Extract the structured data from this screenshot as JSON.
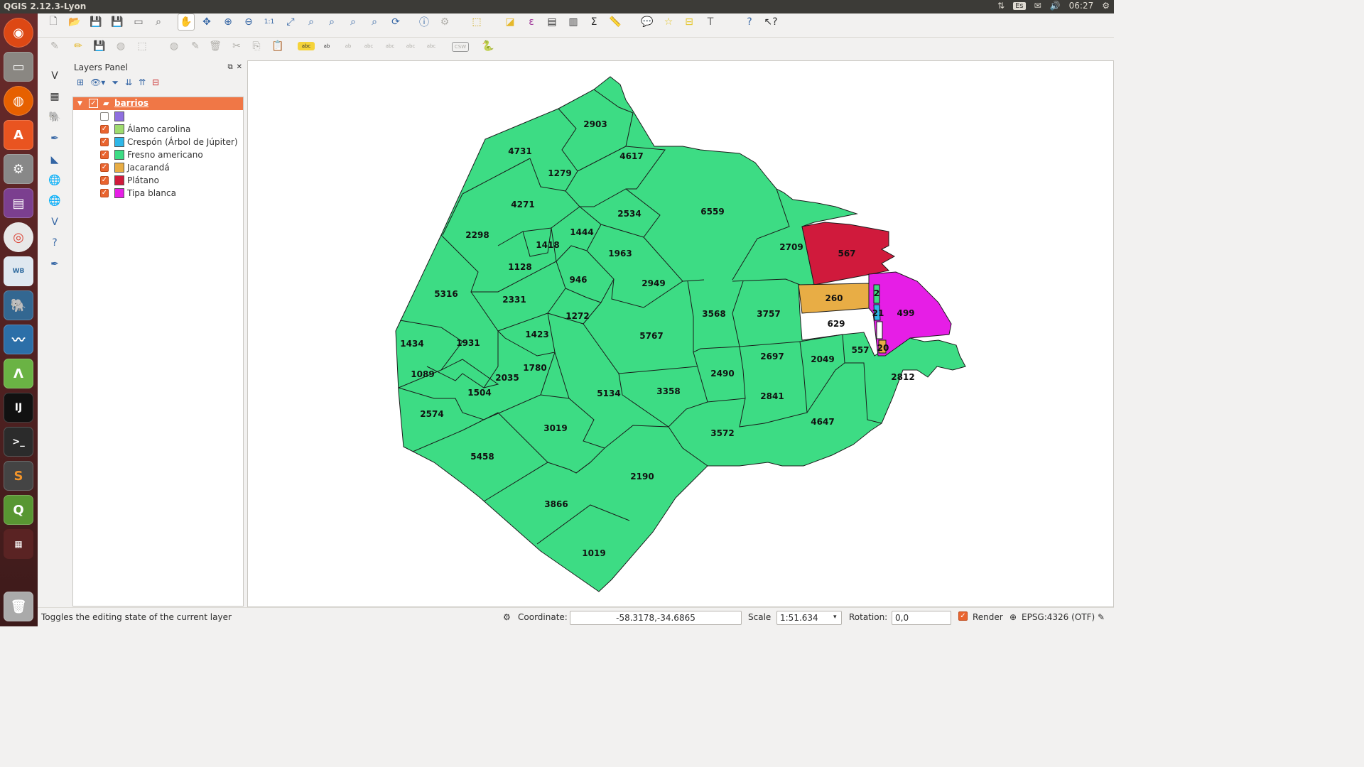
{
  "window": {
    "title": "QGIS 2.12.3-Lyon"
  },
  "tray": {
    "keyboard": "Es",
    "time": "06:27"
  },
  "layers_panel": {
    "title": "Layers Panel",
    "layer_name": "barrios",
    "legend": [
      {
        "label": "",
        "color": "#8f6fe0",
        "checked": false
      },
      {
        "label": "Álamo carolina",
        "color": "#9fdc6e",
        "checked": true
      },
      {
        "label": "Crespón (Árbol de Júpiter)",
        "color": "#2eb7e8",
        "checked": true
      },
      {
        "label": "Fresno americano",
        "color": "#3ddc84",
        "checked": true
      },
      {
        "label": "Jacarandá",
        "color": "#e8ad45",
        "checked": true
      },
      {
        "label": "Plátano",
        "color": "#d01a3c",
        "checked": true
      },
      {
        "label": "Tipa blanca",
        "color": "#e61ee6",
        "checked": true
      }
    ]
  },
  "map": {
    "fill_main": "#3ddc84",
    "fill_platano": "#d01a3c",
    "fill_jacaranda": "#e8ad45",
    "fill_tipa": "#e61ee6",
    "fill_crespon": "#2eb7e8",
    "labels": [
      "2903",
      "4731",
      "4617",
      "1279",
      "4271",
      "2534",
      "6559",
      "2298",
      "1444",
      "1418",
      "1963",
      "2709",
      "567",
      "1128",
      "946",
      "2949",
      "260",
      "499",
      "5316",
      "2331",
      "3568",
      "3757",
      "1272",
      "1423",
      "5767",
      "629",
      "1434",
      "1931",
      "557",
      "1089",
      "1780",
      "2697",
      "2049",
      "2035",
      "2490",
      "2812",
      "1504",
      "5134",
      "3358",
      "2841",
      "2574",
      "3019",
      "4647",
      "3572",
      "5458",
      "2190",
      "3866",
      "1019",
      "2",
      "21",
      "20"
    ]
  },
  "status": {
    "message": "Toggles the editing state of the current layer",
    "coordinate_label": "Coordinate:",
    "coordinate_value": "-58.3178,-34.6865",
    "scale_label": "Scale",
    "scale_value": "1:51.634",
    "rotation_label": "Rotation:",
    "rotation_value": "0,0",
    "render_label": "Render",
    "crs": "EPSG:4326 (OTF)"
  }
}
